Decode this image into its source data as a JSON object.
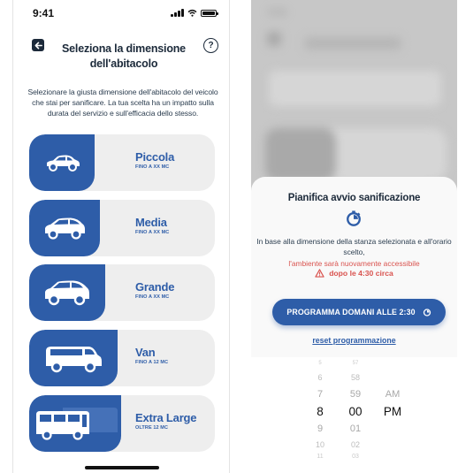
{
  "left_screen": {
    "status_time": "9:41",
    "title": "Seleziona la dimensione dell'abitacolo",
    "help_label": "?",
    "description": "Selezionare la giusta dimensione dell'abitacolo del veicolo che stai per sanificare. La tua scelta ha un impatto sulla durata del servizio e sull'efficacia dello stesso.",
    "sizes": [
      {
        "label": "Piccola",
        "sub": "FINO A XX MC",
        "icon": "small-car-icon"
      },
      {
        "label": "Media",
        "sub": "FINO A XX MC",
        "icon": "medium-car-icon"
      },
      {
        "label": "Grande",
        "sub": "FINO A XX MC",
        "icon": "large-car-icon"
      },
      {
        "label": "Van",
        "sub": "FINO A 12 MC",
        "icon": "van-icon"
      },
      {
        "label": "Extra Large",
        "sub": "OLTRE 12 MC",
        "icon": "bus-icon"
      }
    ]
  },
  "right_screen": {
    "status_time": "9:41",
    "sheet": {
      "title": "Pianifica avvio sanificazione",
      "info": "In base alla dimensione della stanza selezionata e all'orario scelto,",
      "warning": "l'ambiente sarà nuovamente accessibile",
      "warning_time": "dopo le 4:30 circa",
      "schedule_button": "PROGRAMMA DOMANI ALLE 2:30",
      "reset_link": "reset programmazione"
    },
    "picker": {
      "rows": [
        {
          "hour": "5",
          "minute": "57",
          "ampm": ""
        },
        {
          "hour": "6",
          "minute": "58",
          "ampm": ""
        },
        {
          "hour": "7",
          "minute": "59",
          "ampm": "AM"
        },
        {
          "hour": "8",
          "minute": "00",
          "ampm": "PM"
        },
        {
          "hour": "9",
          "minute": "01",
          "ampm": ""
        },
        {
          "hour": "10",
          "minute": "02",
          "ampm": ""
        },
        {
          "hour": "11",
          "minute": "03",
          "ampm": ""
        }
      ],
      "selected_index": 3
    }
  },
  "colors": {
    "brand_blue": "#2e5da8",
    "card_bg": "#eeeeee",
    "warning_red": "#d9534f",
    "dark_text": "#1c2a3a"
  }
}
